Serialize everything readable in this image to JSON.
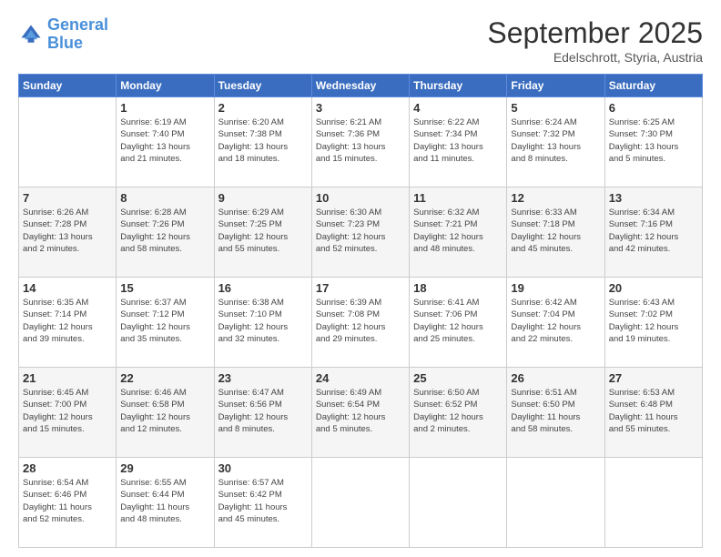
{
  "logo": {
    "line1": "General",
    "line2": "Blue"
  },
  "header": {
    "month": "September 2025",
    "location": "Edelschrott, Styria, Austria"
  },
  "weekdays": [
    "Sunday",
    "Monday",
    "Tuesday",
    "Wednesday",
    "Thursday",
    "Friday",
    "Saturday"
  ],
  "weeks": [
    [
      {
        "day": "",
        "info": ""
      },
      {
        "day": "1",
        "info": "Sunrise: 6:19 AM\nSunset: 7:40 PM\nDaylight: 13 hours\nand 21 minutes."
      },
      {
        "day": "2",
        "info": "Sunrise: 6:20 AM\nSunset: 7:38 PM\nDaylight: 13 hours\nand 18 minutes."
      },
      {
        "day": "3",
        "info": "Sunrise: 6:21 AM\nSunset: 7:36 PM\nDaylight: 13 hours\nand 15 minutes."
      },
      {
        "day": "4",
        "info": "Sunrise: 6:22 AM\nSunset: 7:34 PM\nDaylight: 13 hours\nand 11 minutes."
      },
      {
        "day": "5",
        "info": "Sunrise: 6:24 AM\nSunset: 7:32 PM\nDaylight: 13 hours\nand 8 minutes."
      },
      {
        "day": "6",
        "info": "Sunrise: 6:25 AM\nSunset: 7:30 PM\nDaylight: 13 hours\nand 5 minutes."
      }
    ],
    [
      {
        "day": "7",
        "info": "Sunrise: 6:26 AM\nSunset: 7:28 PM\nDaylight: 13 hours\nand 2 minutes."
      },
      {
        "day": "8",
        "info": "Sunrise: 6:28 AM\nSunset: 7:26 PM\nDaylight: 12 hours\nand 58 minutes."
      },
      {
        "day": "9",
        "info": "Sunrise: 6:29 AM\nSunset: 7:25 PM\nDaylight: 12 hours\nand 55 minutes."
      },
      {
        "day": "10",
        "info": "Sunrise: 6:30 AM\nSunset: 7:23 PM\nDaylight: 12 hours\nand 52 minutes."
      },
      {
        "day": "11",
        "info": "Sunrise: 6:32 AM\nSunset: 7:21 PM\nDaylight: 12 hours\nand 48 minutes."
      },
      {
        "day": "12",
        "info": "Sunrise: 6:33 AM\nSunset: 7:18 PM\nDaylight: 12 hours\nand 45 minutes."
      },
      {
        "day": "13",
        "info": "Sunrise: 6:34 AM\nSunset: 7:16 PM\nDaylight: 12 hours\nand 42 minutes."
      }
    ],
    [
      {
        "day": "14",
        "info": "Sunrise: 6:35 AM\nSunset: 7:14 PM\nDaylight: 12 hours\nand 39 minutes."
      },
      {
        "day": "15",
        "info": "Sunrise: 6:37 AM\nSunset: 7:12 PM\nDaylight: 12 hours\nand 35 minutes."
      },
      {
        "day": "16",
        "info": "Sunrise: 6:38 AM\nSunset: 7:10 PM\nDaylight: 12 hours\nand 32 minutes."
      },
      {
        "day": "17",
        "info": "Sunrise: 6:39 AM\nSunset: 7:08 PM\nDaylight: 12 hours\nand 29 minutes."
      },
      {
        "day": "18",
        "info": "Sunrise: 6:41 AM\nSunset: 7:06 PM\nDaylight: 12 hours\nand 25 minutes."
      },
      {
        "day": "19",
        "info": "Sunrise: 6:42 AM\nSunset: 7:04 PM\nDaylight: 12 hours\nand 22 minutes."
      },
      {
        "day": "20",
        "info": "Sunrise: 6:43 AM\nSunset: 7:02 PM\nDaylight: 12 hours\nand 19 minutes."
      }
    ],
    [
      {
        "day": "21",
        "info": "Sunrise: 6:45 AM\nSunset: 7:00 PM\nDaylight: 12 hours\nand 15 minutes."
      },
      {
        "day": "22",
        "info": "Sunrise: 6:46 AM\nSunset: 6:58 PM\nDaylight: 12 hours\nand 12 minutes."
      },
      {
        "day": "23",
        "info": "Sunrise: 6:47 AM\nSunset: 6:56 PM\nDaylight: 12 hours\nand 8 minutes."
      },
      {
        "day": "24",
        "info": "Sunrise: 6:49 AM\nSunset: 6:54 PM\nDaylight: 12 hours\nand 5 minutes."
      },
      {
        "day": "25",
        "info": "Sunrise: 6:50 AM\nSunset: 6:52 PM\nDaylight: 12 hours\nand 2 minutes."
      },
      {
        "day": "26",
        "info": "Sunrise: 6:51 AM\nSunset: 6:50 PM\nDaylight: 11 hours\nand 58 minutes."
      },
      {
        "day": "27",
        "info": "Sunrise: 6:53 AM\nSunset: 6:48 PM\nDaylight: 11 hours\nand 55 minutes."
      }
    ],
    [
      {
        "day": "28",
        "info": "Sunrise: 6:54 AM\nSunset: 6:46 PM\nDaylight: 11 hours\nand 52 minutes."
      },
      {
        "day": "29",
        "info": "Sunrise: 6:55 AM\nSunset: 6:44 PM\nDaylight: 11 hours\nand 48 minutes."
      },
      {
        "day": "30",
        "info": "Sunrise: 6:57 AM\nSunset: 6:42 PM\nDaylight: 11 hours\nand 45 minutes."
      },
      {
        "day": "",
        "info": ""
      },
      {
        "day": "",
        "info": ""
      },
      {
        "day": "",
        "info": ""
      },
      {
        "day": "",
        "info": ""
      }
    ]
  ]
}
